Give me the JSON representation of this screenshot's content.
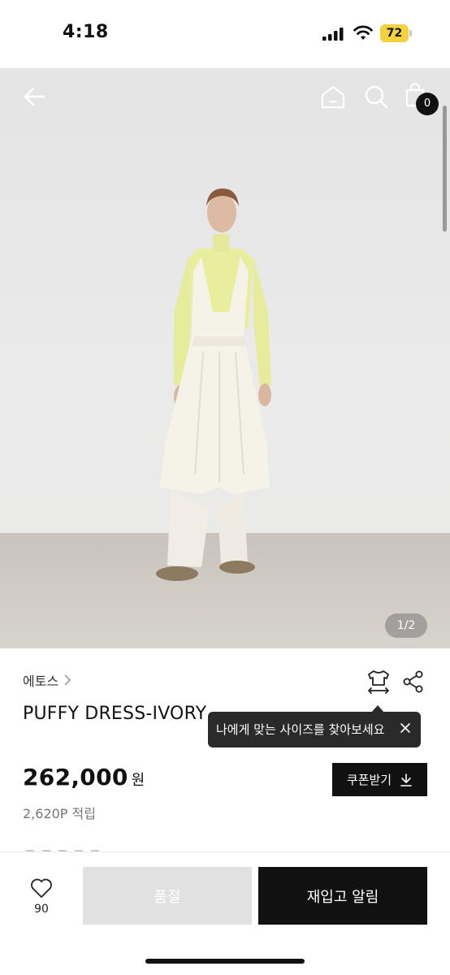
{
  "status_bar": {
    "time": "4:18",
    "battery": "72",
    "battery_color": "#f3d23e"
  },
  "nav": {
    "back_icon": "arrow-left-icon",
    "home_icon": "home-icon",
    "search_icon": "search-icon",
    "bag_icon": "shopping-bag-icon",
    "bag_count": "0"
  },
  "gallery": {
    "page_indicator": "1/2"
  },
  "product": {
    "brand": "에토스",
    "title": "PUFFY DRESS-IVORY",
    "price": "262,000",
    "currency": "원",
    "points": "2,620P 적립"
  },
  "tooltip": {
    "text": "나에게 맞는 사이즈를 찾아보세요"
  },
  "coupon": {
    "label": "쿠폰받기"
  },
  "bottom_bar": {
    "like_count": "90",
    "soldout_label": "품절",
    "restock_label": "재입고 알림"
  },
  "colors": {
    "primary": "#111111",
    "disabled": "#e1e1e1",
    "tooltip_bg": "#2a2a2a"
  }
}
